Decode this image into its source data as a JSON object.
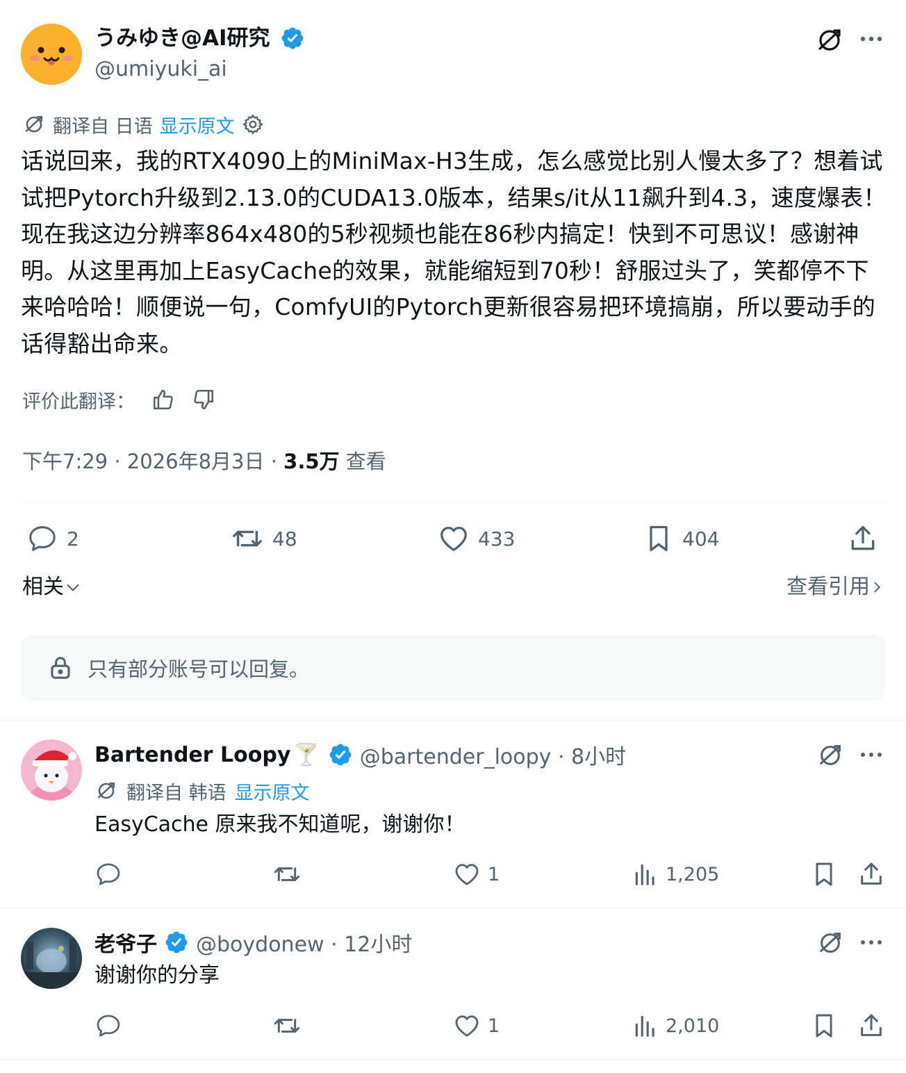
{
  "tweet": {
    "author_name": "うみゆき@AI研究",
    "author_handle": "@umiyuki_ai",
    "translated_from": "翻译自 日语",
    "show_original": "显示原文",
    "text": "话说回来，我的RTX4090上的MiniMax-H3生成，怎么感觉比别人慢太多了？想着试试把Pytorch升级到2.13.0的CUDA13.0版本，结果s/it从11飙升到4.3，速度爆表！现在我这边分辨率864x480的5秒视频也能在86秒内搞定！快到不可思议！感谢神明。从这里再加上EasyCache的效果，就能缩短到70秒！舒服过头了，笑都停不下来哈哈哈！顺便说一句，ComfyUI的Pytorch更新很容易把环境搞崩，所以要动手的话得豁出命来。",
    "rate_label": "评价此翻译：",
    "time": "下午7:29 · 2026年8月3日 · ",
    "views_count": "3.5万",
    "views_label": " 查看",
    "replies": "2",
    "retweets": "48",
    "likes": "433",
    "bookmarks": "404",
    "related_label": "相关",
    "quotes_label": "查看引用",
    "reply_restriction": "只有部分账号可以回复。"
  },
  "replies": [
    {
      "name": "Bartender Loopy",
      "emoji": "🍸",
      "handle": "@bartender_loopy · 8小时",
      "translated_from": "翻译自 韩语",
      "show_original": "显示原文",
      "text": "EasyCache 原来我不知道呢，谢谢你！",
      "likes": "1",
      "views": "1,205"
    },
    {
      "name": "老爷子",
      "handle": "@boydonew · 12小时",
      "text": "谢谢你的分享",
      "likes": "1",
      "views": "2,010"
    }
  ],
  "icons": {
    "translate": "no-translate-icon",
    "more": "more-dots-icon",
    "settings": "gear-icon",
    "verified": "verified-badge-icon",
    "thumbs_up": "thumbs-up-icon",
    "thumbs_down": "thumbs-down-icon",
    "reply": "speech-bubble-icon",
    "retweet": "retweet-icon",
    "like": "heart-icon",
    "bookmark": "bookmark-icon",
    "share": "share-icon",
    "views": "bar-chart-icon",
    "lock": "lock-icon",
    "chevron_down": "chevron-down-icon",
    "chevron_right": "chevron-right-icon"
  },
  "colors": {
    "text": "#0f1419",
    "muted": "#536471",
    "accent": "#1d9bf0",
    "divider": "#eff3f4",
    "reply_box_bg": "#f7f9f9",
    "avatar_main_bg": "#fbb12a"
  }
}
